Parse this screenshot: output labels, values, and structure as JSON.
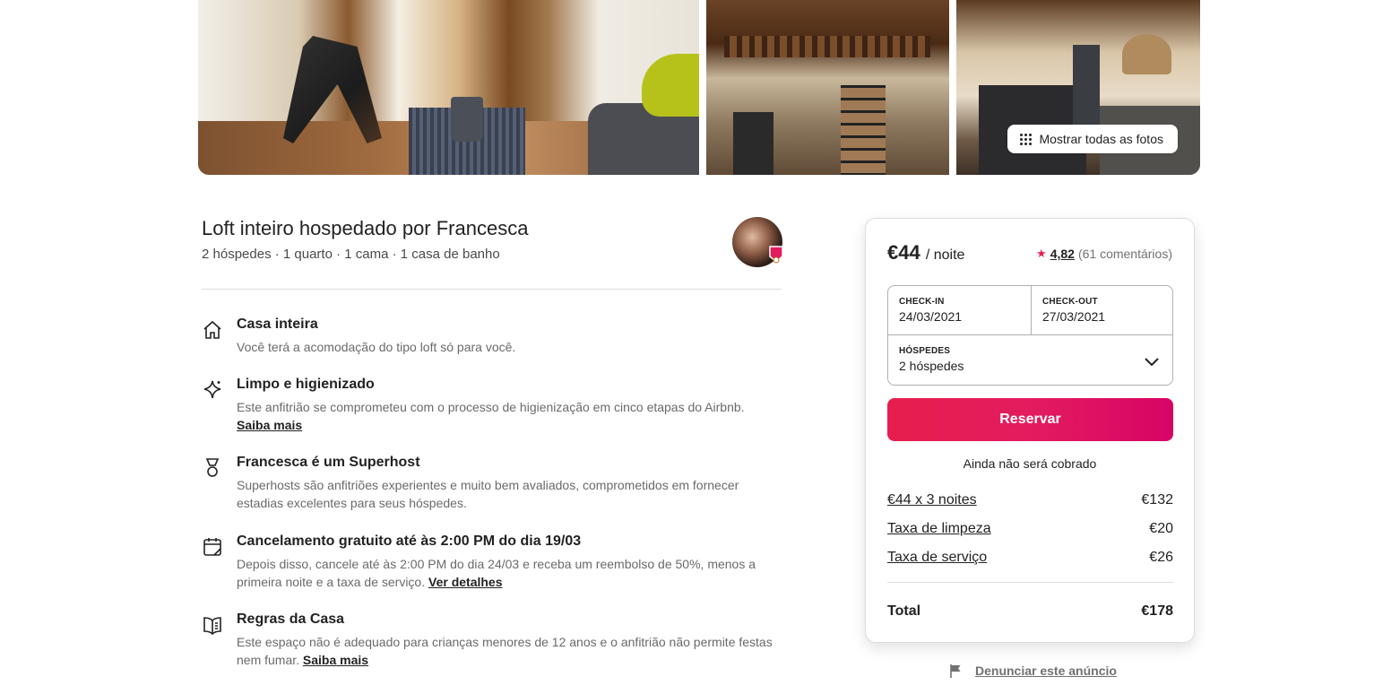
{
  "gallery": {
    "show_all_label": "Mostrar todas as fotos"
  },
  "listing": {
    "title": "Loft inteiro hospedado por Francesca",
    "subtitle": "2 hóspedes · 1 quarto · 1 cama · 1 casa de banho"
  },
  "features": [
    {
      "icon": "home-icon",
      "title": "Casa inteira",
      "desc": "Você terá a acomodação do tipo loft só para você."
    },
    {
      "icon": "sparkle-icon",
      "title": "Limpo e higienizado",
      "desc": "Este anfitrião se comprometeu com o processo de higienização em cinco etapas do Airbnb.",
      "link": "Saiba mais"
    },
    {
      "icon": "medal-icon",
      "title": "Francesca é um Superhost",
      "desc": "Superhosts são anfitriões experientes e muito bem avaliados, comprometidos em fornecer estadias excelentes para seus hóspedes."
    },
    {
      "icon": "calendar-icon",
      "title": "Cancelamento gratuito até às 2:00 PM do dia 19/03",
      "desc": "Depois disso, cancele até às 2:00 PM do dia 24/03 e receba um reembolso de 50%, menos a primeira noite e a taxa de serviço.",
      "link": "Ver detalhes"
    },
    {
      "icon": "book-icon",
      "title": "Regras da Casa",
      "desc": "Este espaço não é adequado para crianças menores de 12 anos e o anfitrião não permite festas nem fumar.",
      "link": "Saiba mais"
    }
  ],
  "booking": {
    "price": "€44",
    "per_night": "/ noite",
    "rating": "4,82",
    "reviews": "(61 comentários)",
    "checkin_label": "CHECK-IN",
    "checkin_value": "24/03/2021",
    "checkout_label": "CHECK-OUT",
    "checkout_value": "27/03/2021",
    "guests_label": "HÓSPEDES",
    "guests_value": "2 hóspedes",
    "reserve_label": "Reservar",
    "no_charge": "Ainda não será cobrado",
    "lines": [
      {
        "label": "€44 x 3 noites",
        "amount": "€132"
      },
      {
        "label": "Taxa de limpeza",
        "amount": "€20"
      },
      {
        "label": "Taxa de serviço",
        "amount": "€26"
      }
    ],
    "total_label": "Total",
    "total_amount": "€178"
  },
  "report_label": "Denunciar este anúncio",
  "colors": {
    "accent": "#e31c5f",
    "star": "#e51d52"
  }
}
